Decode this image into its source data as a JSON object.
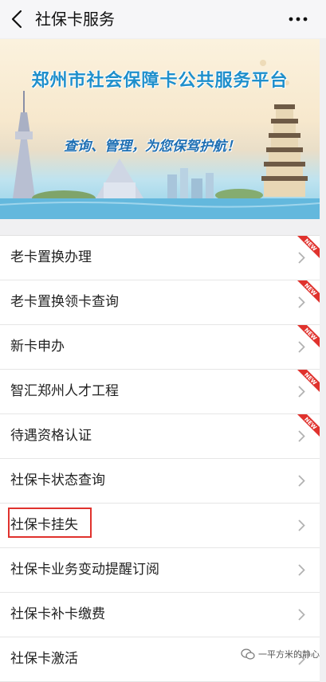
{
  "header": {
    "title": "社保卡服务"
  },
  "banner": {
    "title": "郑州市社会保障卡公共服务平台",
    "slogan": "查询、管理，为您保驾护航！"
  },
  "items": [
    {
      "label": "老卡置换办理",
      "badge": "NEW"
    },
    {
      "label": "老卡置换领卡查询",
      "badge": "NEW"
    },
    {
      "label": "新卡申办",
      "badge": "NEW"
    },
    {
      "label": "智汇郑州人才工程",
      "badge": "NEW"
    },
    {
      "label": "待遇资格认证",
      "badge": "NEW"
    },
    {
      "label": "社保卡状态查询"
    },
    {
      "label": "社保卡挂失"
    },
    {
      "label": "社保卡业务变动提醒订阅"
    },
    {
      "label": "社保卡补卡缴费"
    },
    {
      "label": "社保卡激活"
    }
  ],
  "watermark": {
    "text": "一平方米的静心"
  },
  "colors": {
    "accent_red": "#e0322d",
    "banner_blue": "#1f8fcb"
  }
}
